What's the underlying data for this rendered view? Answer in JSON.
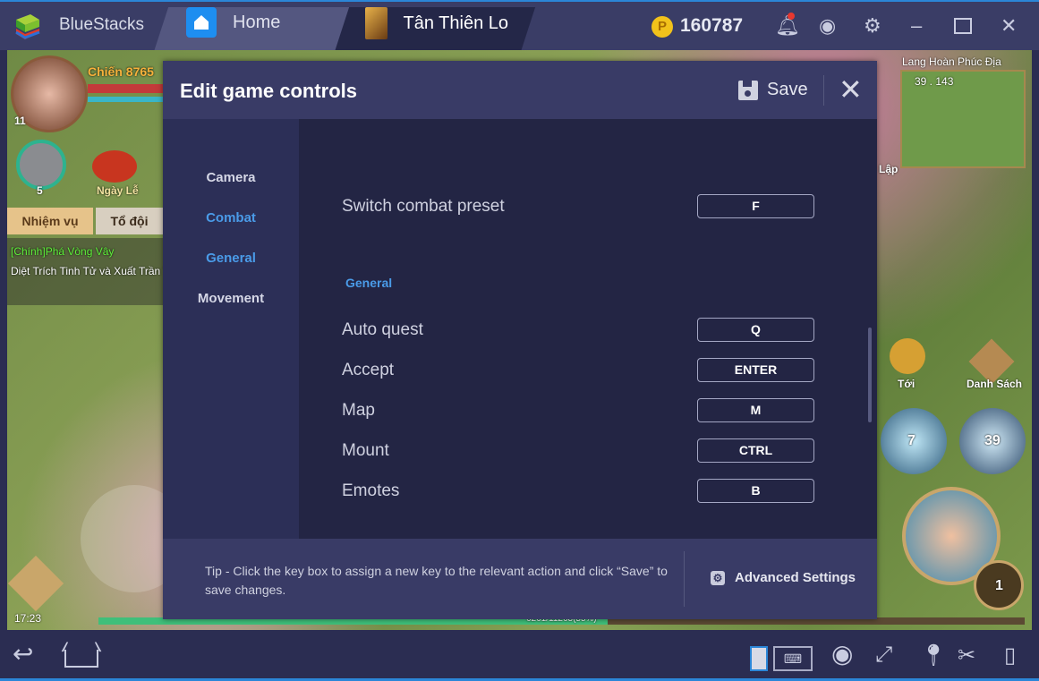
{
  "titlebar": {
    "brand": "BlueStacks",
    "tabs": [
      {
        "label": "Home",
        "icon": "home-icon"
      },
      {
        "label": "Tân Thiên Lo",
        "icon": "game-icon"
      }
    ],
    "coins": "160787",
    "icons": [
      "bell-icon",
      "profile-icon",
      "gear-icon",
      "minimize-icon",
      "maximize-icon",
      "close-icon"
    ]
  },
  "game": {
    "power": "Chiến 8765",
    "level": "11",
    "pet_level": "5",
    "holiday": "Ngày Lễ",
    "quest_btn": "Nhiệm vụ",
    "team_btn": "Tổ đội",
    "quest_title": "[Chính]Phá Vòng Vây",
    "quest_desc": "Diệt Trích Tinh Tử và Xuất Trần Tử",
    "map_name": "Lang Hoàn Phúc Địa",
    "coords": "39 . 143",
    "lap": "Lập",
    "toi": "Tới",
    "danh_sach": "Danh Sách",
    "skill1": "7",
    "skill2": "39",
    "skill3": "1",
    "time": "17:23",
    "xp": "6261/11263(55%)",
    "xp_percent": 55
  },
  "dialog": {
    "title": "Edit game controls",
    "save": "Save",
    "sidebar": [
      {
        "label": "Camera",
        "active": false
      },
      {
        "label": "Combat",
        "active": true
      },
      {
        "label": "General",
        "active": true
      },
      {
        "label": "Movement",
        "active": false
      }
    ],
    "combat_row": {
      "label": "Switch combat preset",
      "key": "F"
    },
    "general_section": "General",
    "general_rows": [
      {
        "label": "Auto quest",
        "key": "Q"
      },
      {
        "label": "Accept",
        "key": "ENTER"
      },
      {
        "label": "Map",
        "key": "M"
      },
      {
        "label": "Mount",
        "key": "CTRL"
      },
      {
        "label": "Emotes",
        "key": "B"
      }
    ],
    "tip": "Tip - Click the key box to assign a new key to the relevant action and click “Save” to save changes.",
    "advanced": "Advanced Settings"
  },
  "bottombar": {
    "icons": [
      "back-icon",
      "home-icon",
      "keyboard-toggle-icon",
      "keyboard-icon",
      "eye-icon",
      "fullscreen-icon",
      "location-icon",
      "scissors-icon",
      "shake-icon"
    ]
  },
  "colors": {
    "accent": "#4a9be8",
    "header": "#393b66",
    "sidebar": "#2c2f57",
    "content": "#232544",
    "frame_border": "#2b86d8"
  }
}
